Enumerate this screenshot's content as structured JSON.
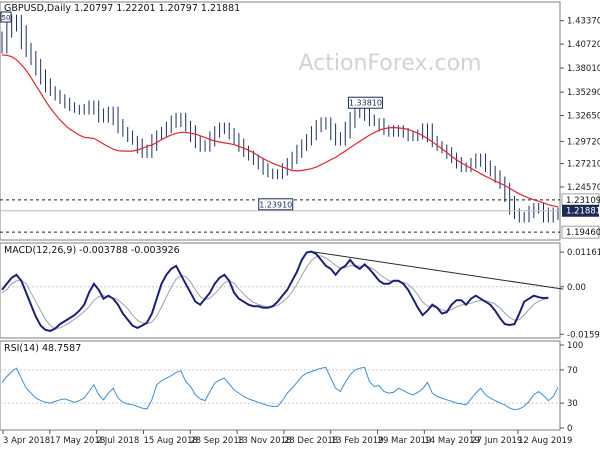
{
  "header": {
    "symbol_ohlc": "GBPUSD,Daily  1.20797  1.22201  1.20797  1.21881",
    "ma_tag": "50"
  },
  "watermark": "ActionForex.com",
  "colors": {
    "price_bars": "#1c2f63",
    "ma": "#e0262b",
    "macd_line": "#1b1f7a",
    "macd_signal": "#9aa2aa",
    "rsi": "#3a8fd6",
    "price_box_bg": "#1a2b56",
    "level_dash": "#202020",
    "trendline": "#2a2a2a",
    "grid": "#c8c8c8",
    "watermark": "#cfd3d8"
  },
  "chart_data": [
    {
      "type": "line",
      "title": "GBPUSD,Daily",
      "price_scale": {
        "min": 1.188,
        "max": 1.448
      },
      "y_tick_labels": [
        "1.43370",
        "1.40720",
        "1.38010",
        "1.35290",
        "1.32650",
        "1.29720",
        "1.27210",
        "1.24570"
      ],
      "y_tick_values": [
        1.4337,
        1.4072,
        1.3801,
        1.3529,
        1.3265,
        1.2972,
        1.2721,
        1.2457
      ],
      "x_categories": [
        "3 Apr 2018",
        "17 May 2018",
        "2 Jul 2018",
        "15 Aug 2018",
        "28 Sep 2018",
        "13 Nov 2018",
        "28 Dec 2018",
        "13 Feb 2019",
        "29 Mar 2019",
        "14 May 2019",
        "27 Jun 2019",
        "12 Aug 2019"
      ],
      "series": [
        {
          "role": "price",
          "values": [
            1.4,
            1.418,
            1.43,
            1.437,
            1.425,
            1.405,
            1.396,
            1.387,
            1.375,
            1.365,
            1.356,
            1.352,
            1.347,
            1.343,
            1.338,
            1.335,
            1.333,
            1.331,
            1.336,
            1.34,
            1.331,
            1.322,
            1.327,
            1.333,
            1.319,
            1.31,
            1.306,
            1.3,
            1.297,
            1.287,
            1.282,
            1.29,
            1.302,
            1.306,
            1.31,
            1.316,
            1.323,
            1.326,
            1.317,
            1.312,
            1.3,
            1.293,
            1.289,
            1.295,
            1.305,
            1.311,
            1.315,
            1.309,
            1.303,
            1.297,
            1.289,
            1.283,
            1.279,
            1.274,
            1.269,
            1.263,
            1.26,
            1.258,
            1.262,
            1.269,
            1.275,
            1.282,
            1.29,
            1.296,
            1.302,
            1.311,
            1.318,
            1.321,
            1.314,
            1.302,
            1.296,
            1.304,
            1.316,
            1.327,
            1.333,
            1.338,
            1.324,
            1.318,
            1.32,
            1.312,
            1.308,
            1.306,
            1.312,
            1.309,
            1.305,
            1.301,
            1.303,
            1.307,
            1.314,
            1.3,
            1.294,
            1.29,
            1.287,
            1.281,
            1.276,
            1.27,
            1.266,
            1.27,
            1.275,
            1.28,
            1.272,
            1.266,
            1.261,
            1.254,
            1.247,
            1.232,
            1.218,
            1.213,
            1.209,
            1.214,
            1.221,
            1.224,
            1.219,
            1.209,
            1.212,
            1.219
          ]
        },
        {
          "role": "moving-average",
          "values": [
            1.395,
            1.3945,
            1.393,
            1.3895,
            1.384,
            1.3775,
            1.3695,
            1.3605,
            1.352,
            1.343,
            1.335,
            1.328,
            1.3215,
            1.316,
            1.311,
            1.3078,
            1.3042,
            1.3018,
            1.3012,
            1.3006,
            1.2976,
            1.2943,
            1.2913,
            1.2885,
            1.2867,
            1.2864,
            1.2862,
            1.2862,
            1.2875,
            1.2892,
            1.2917,
            1.2931,
            1.296,
            1.2992,
            1.302,
            1.3045,
            1.3062,
            1.3075,
            1.3075,
            1.3065,
            1.3055,
            1.3035,
            1.3015,
            1.2994,
            1.2976,
            1.2965,
            1.2955,
            1.2947,
            1.2935,
            1.2917,
            1.2895,
            1.2873,
            1.2844,
            1.281,
            1.2779,
            1.275,
            1.2725,
            1.2703,
            1.2684,
            1.2663,
            1.2642,
            1.2638,
            1.2643,
            1.2653,
            1.2663,
            1.2681,
            1.2709,
            1.2735,
            1.2765,
            1.2791,
            1.2828,
            1.2862,
            1.2902,
            1.2937,
            1.2972,
            1.3007,
            1.3043,
            1.3071,
            1.3097,
            1.3115,
            1.3125,
            1.3129,
            1.3123,
            1.3119,
            1.3105,
            1.3087,
            1.3065,
            1.3037,
            1.3004,
            1.2969,
            1.2928,
            1.2887,
            1.2847,
            1.2803,
            1.2764,
            1.2729,
            1.2699,
            1.2668,
            1.2638,
            1.2607,
            1.2578,
            1.2553,
            1.2522,
            1.2499,
            1.2473,
            1.2441,
            1.2409,
            1.238,
            1.2354,
            1.2331,
            1.2312,
            1.2296,
            1.2277,
            1.2256,
            1.2244,
            1.2233
          ]
        }
      ],
      "annotations": [
        {
          "text": "1.33810",
          "value": 1.3381
        },
        {
          "text": "1.23910",
          "value": 1.2391
        }
      ],
      "reference_levels": [
        {
          "value": 1.23109,
          "label": "1.23109",
          "style": "dashed"
        },
        {
          "value": 1.21881,
          "label": "1.21881",
          "style": "solid",
          "boxed": true
        },
        {
          "value": 1.1946,
          "label": "1.19460",
          "style": "dashed"
        }
      ]
    },
    {
      "type": "line",
      "title": "MACD(12,26,9) -0.003788 -0.003926",
      "y_range": [
        -0.0165,
        0.013
      ],
      "y_tick_labels": [
        "0.011619",
        "0.00",
        "-0.015949"
      ],
      "y_tick_values": [
        0.011619,
        0,
        -0.015949
      ],
      "series": [
        {
          "role": "macd",
          "values": [
            -0.001,
            0.001,
            0.003,
            0.004,
            0.002,
            -0.002,
            -0.006,
            -0.01,
            -0.013,
            -0.0145,
            -0.0148,
            -0.014,
            -0.0125,
            -0.0115,
            -0.0105,
            -0.0095,
            -0.008,
            -0.006,
            -0.002,
            0.001,
            -0.001,
            -0.004,
            -0.003,
            -0.004,
            -0.006,
            -0.009,
            -0.011,
            -0.013,
            -0.0138,
            -0.013,
            -0.012,
            -0.009,
            -0.004,
            0.001,
            0.004,
            0.006,
            0.007,
            0.004,
            0.001,
            -0.002,
            -0.005,
            -0.006,
            -0.004,
            -0.002,
            0.001,
            0.003,
            0.004,
            0.002,
            -0.002,
            -0.004,
            -0.005,
            -0.006,
            -0.0065,
            -0.0065,
            -0.007,
            -0.007,
            -0.0065,
            -0.005,
            -0.003,
            -0.001,
            0.002,
            0.005,
            0.009,
            0.0115,
            0.0118,
            0.011,
            0.009,
            0.007,
            0.006,
            0.004,
            0.006,
            0.007,
            0.009,
            0.007,
            0.006,
            0.0075,
            0.006,
            0.004,
            0.002,
            0.001,
            0.001,
            0.002,
            0.002,
            0.001,
            -0.001,
            -0.004,
            -0.007,
            -0.0095,
            -0.008,
            -0.006,
            -0.007,
            -0.009,
            -0.0085,
            -0.006,
            -0.0045,
            -0.0045,
            -0.006,
            -0.004,
            -0.003,
            -0.004,
            -0.005,
            -0.006,
            -0.008,
            -0.0105,
            -0.0125,
            -0.0128,
            -0.0125,
            -0.009,
            -0.005,
            -0.004,
            -0.003,
            -0.0035,
            -0.0038,
            -0.0037
          ]
        },
        {
          "role": "signal",
          "values": [
            -0.002,
            -0.001,
            0.001,
            0.002,
            0.002,
            0.001,
            -0.002,
            -0.005,
            -0.008,
            -0.011,
            -0.013,
            -0.014,
            -0.0138,
            -0.013,
            -0.012,
            -0.0108,
            -0.0097,
            -0.0083,
            -0.0067,
            -0.0046,
            -0.0033,
            -0.003,
            -0.0034,
            -0.0037,
            -0.0044,
            -0.0058,
            -0.0073,
            -0.0095,
            -0.0112,
            -0.0121,
            -0.0124,
            -0.0118,
            -0.0098,
            -0.0068,
            -0.0034,
            -0.0002,
            0.0026,
            0.0037,
            0.0034,
            0.0016,
            -0.0009,
            -0.0033,
            -0.0043,
            -0.0038,
            -0.0024,
            -0.0005,
            0.0013,
            0.002,
            0.0012,
            -0.0007,
            -0.0025,
            -0.004,
            -0.0052,
            -0.0059,
            -0.0064,
            -0.0067,
            -0.0067,
            -0.0062,
            -0.0052,
            -0.0037,
            -0.0017,
            0.0008,
            0.0038,
            0.0066,
            0.0088,
            0.0101,
            0.0104,
            0.0097,
            0.0085,
            0.0071,
            0.0063,
            0.0064,
            0.0071,
            0.0072,
            0.0069,
            0.007,
            0.0067,
            0.0057,
            0.0043,
            0.0031,
            0.0021,
            0.0018,
            0.0017,
            0.0015,
            0.0008,
            -0.0007,
            -0.0027,
            -0.0051,
            -0.0065,
            -0.0067,
            -0.007,
            -0.0077,
            -0.0082,
            -0.0077,
            -0.0068,
            -0.0061,
            -0.0059,
            -0.0055,
            -0.0049,
            -0.0046,
            -0.0047,
            -0.0051,
            -0.0058,
            -0.0071,
            -0.0088,
            -0.0103,
            -0.0112,
            -0.011,
            -0.0095,
            -0.0076,
            -0.0059,
            -0.0048,
            -0.0042,
            -0.0039
          ]
        }
      ],
      "trendline": {
        "from": {
          "index": 64,
          "value": 0.0118
        },
        "to": {
          "index": 114,
          "value": -0.0003
        }
      }
    },
    {
      "type": "line",
      "title": "RSI(14) 48.7587",
      "y_range": [
        0,
        100
      ],
      "y_tick_labels": [
        "100",
        "70",
        "30",
        "0"
      ],
      "y_tick_values": [
        100,
        70,
        30,
        0
      ],
      "series": [
        {
          "role": "rsi",
          "values": [
            55,
            62,
            68,
            72,
            60,
            48,
            42,
            36,
            33,
            31,
            30,
            32,
            34,
            35,
            33,
            31,
            33,
            36,
            44,
            52,
            40,
            34,
            42,
            48,
            36,
            31,
            29,
            28,
            26,
            24,
            23,
            34,
            52,
            57,
            60,
            63,
            67,
            69,
            56,
            50,
            40,
            35,
            33,
            44,
            54,
            58,
            60,
            53,
            46,
            42,
            38,
            35,
            33,
            31,
            29,
            27,
            26,
            26,
            33,
            42,
            48,
            55,
            62,
            66,
            68,
            70,
            72,
            73,
            60,
            48,
            44,
            55,
            64,
            70,
            72,
            73,
            56,
            50,
            51,
            44,
            42,
            43,
            48,
            45,
            42,
            40,
            43,
            47,
            55,
            42,
            38,
            36,
            34,
            32,
            30,
            29,
            28,
            35,
            42,
            48,
            40,
            36,
            33,
            30,
            28,
            24,
            22,
            23,
            26,
            32,
            40,
            44,
            39,
            33,
            38,
            48.76
          ]
        }
      ]
    }
  ]
}
